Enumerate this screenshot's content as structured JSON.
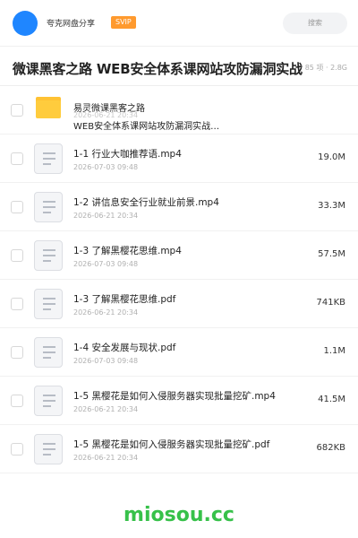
{
  "header": {
    "brand": "夸克网盘分享",
    "badge": "SVIP",
    "search_placeholder": "搜索"
  },
  "share": {
    "title": "微课黑客之路 WEB安全体系课网站攻防漏洞实战",
    "meta": "85 项 · 2.8G"
  },
  "folder": {
    "name_line1": "易灵微课黑客之路",
    "name_line2": "WEB安全体系课网站攻防漏洞实战…",
    "date": "2026-06-21 20:34"
  },
  "files": [
    {
      "name": "1-1 行业大咖推荐语.mp4",
      "date": "2026-07-03 09:48",
      "size": "19.0M"
    },
    {
      "name": "1-2 讲信息安全行业就业前景.mp4",
      "date": "2026-06-21 20:34",
      "size": "33.3M"
    },
    {
      "name": "1-3 了解黑樱花思维.mp4",
      "date": "2026-07-03 09:48",
      "size": "57.5M"
    },
    {
      "name": "1-3 了解黑樱花思维.pdf",
      "date": "2026-06-21 20:34",
      "size": "741KB"
    },
    {
      "name": "1-4 安全发展与现状.pdf",
      "date": "2026-07-03 09:48",
      "size": "1.1M"
    },
    {
      "name": "1-5 黑樱花是如何入侵服务器实现批量挖矿.mp4",
      "date": "2026-06-21 20:34",
      "size": "41.5M"
    },
    {
      "name": "1-5 黑樱花是如何入侵服务器实现批量挖矿.pdf",
      "date": "2026-06-21 20:34",
      "size": "682KB"
    }
  ],
  "watermark": "miosou.cc",
  "colors": {
    "accent": "#1f86ff",
    "svip": "#ff9a2e",
    "folder": "#ffcc3d",
    "watermark": "#37c14a"
  }
}
